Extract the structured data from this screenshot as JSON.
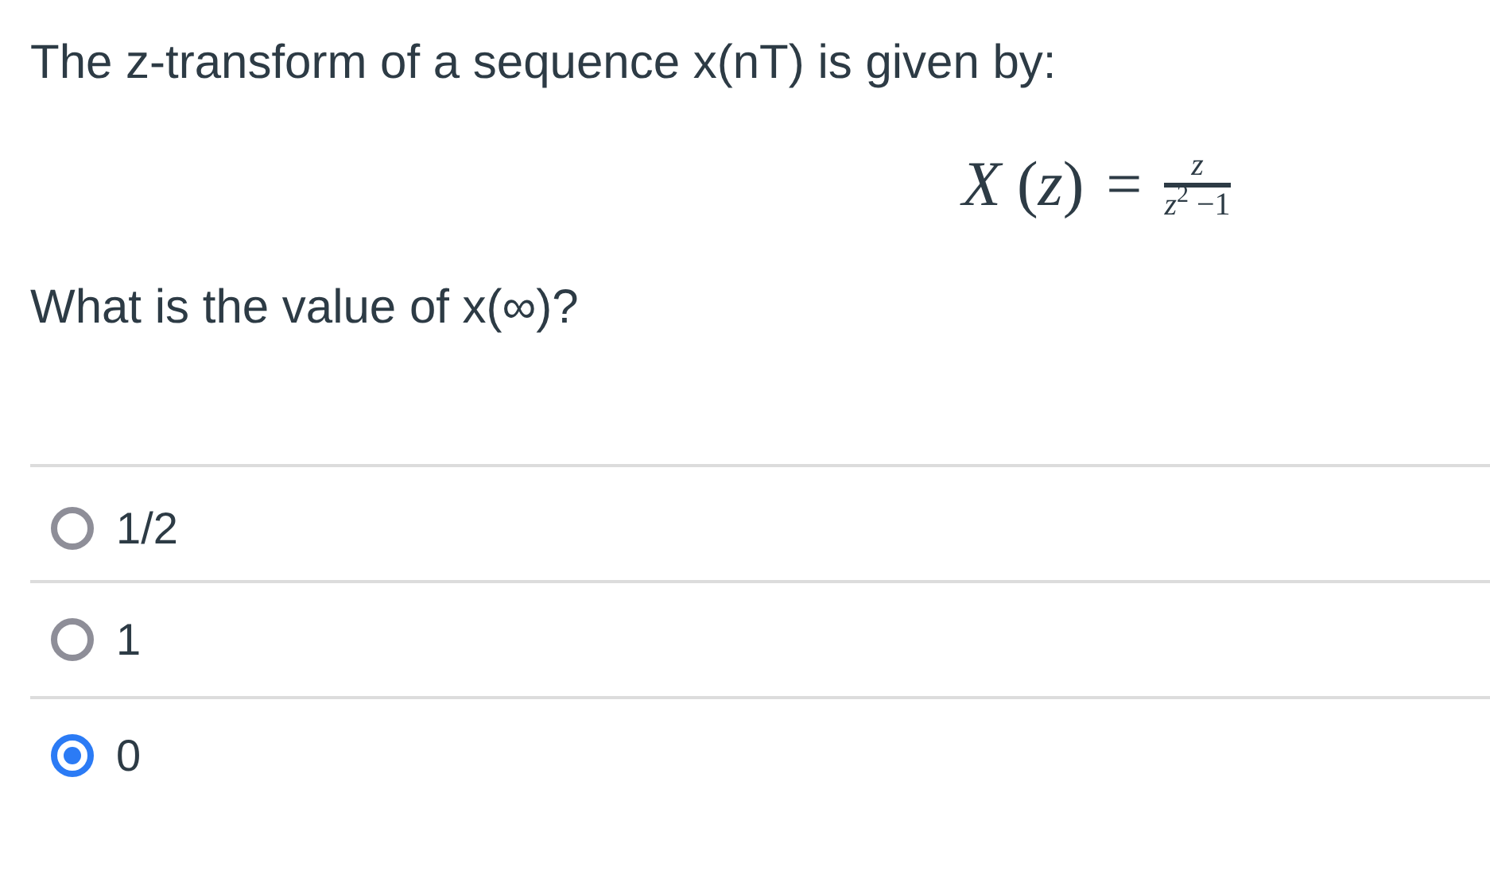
{
  "question": {
    "intro": "The z-transform of a sequence x(nT) is given by:",
    "formula": {
      "lhs": "*X* (*z*)",
      "equals": "=",
      "numerator": "*z*",
      "denominator": "*z*$^{2}$ −1"
    },
    "prompt": "What is the value of x(∞)?"
  },
  "options": [
    {
      "label": "1/2",
      "selected": false
    },
    {
      "label": "1",
      "selected": false
    },
    {
      "label": "0",
      "selected": true
    }
  ]
}
